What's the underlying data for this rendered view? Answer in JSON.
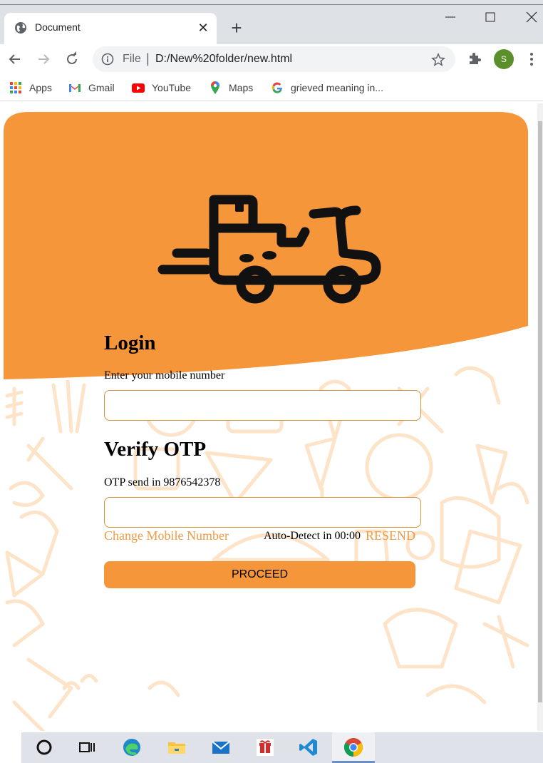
{
  "browser": {
    "tab_title": "Document",
    "url_scheme_label": "File",
    "url": "D:/New%20folder/new.html",
    "profile_initial": "S",
    "bookmarks": [
      {
        "label": "Apps",
        "icon": "apps-grid-icon"
      },
      {
        "label": "Gmail",
        "icon": "gmail-icon"
      },
      {
        "label": "YouTube",
        "icon": "youtube-icon"
      },
      {
        "label": "Maps",
        "icon": "maps-icon"
      },
      {
        "label": "grieved meaning in...",
        "icon": "google-icon"
      }
    ]
  },
  "colors": {
    "brand_orange": "#f5963a",
    "link_orange": "#f29b42",
    "pattern_tint": "#fde3c8",
    "input_border": "#d7923a"
  },
  "login": {
    "title": "Login",
    "mobile_label": "Enter your mobile number",
    "mobile_value": ""
  },
  "verify": {
    "title": "Verify OTP",
    "otp_label": "OTP send in 9876542378",
    "otp_value": "",
    "change_number": "Change Mobile Number",
    "autodetect": "Auto-Detect in 00:00",
    "resend": "RESEND",
    "proceed": "PROCEED"
  },
  "taskbar": {
    "apps": [
      "cortana-icon",
      "task-view-icon",
      "edge-icon",
      "file-explorer-icon",
      "mail-icon",
      "gift-icon",
      "vscode-icon",
      "chrome-icon"
    ]
  }
}
